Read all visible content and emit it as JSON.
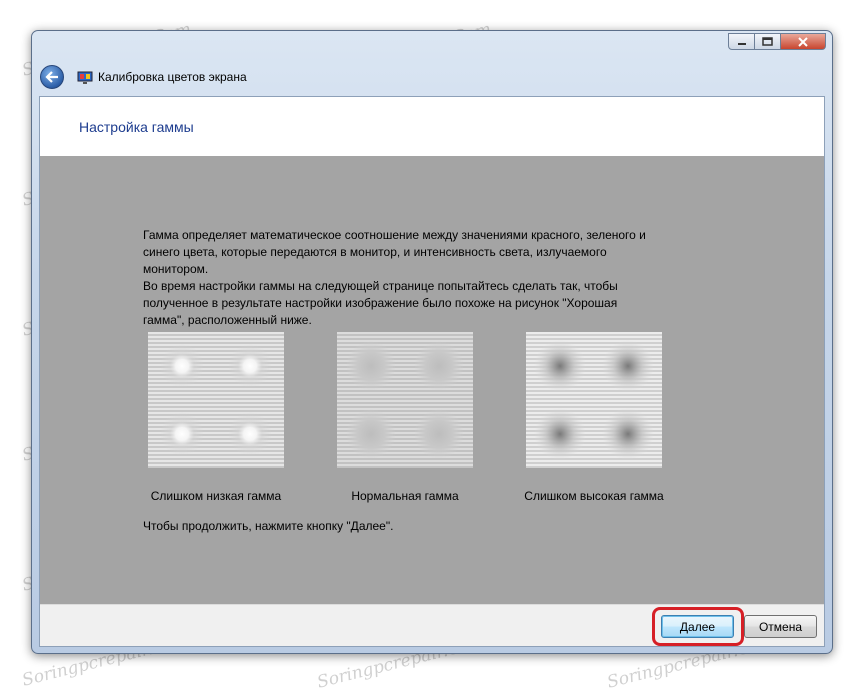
{
  "window": {
    "title": "Калибровка цветов экрана",
    "caption_buttons": [
      "minimize-icon",
      "maximize-icon",
      "close-icon"
    ]
  },
  "page": {
    "heading": "Настройка гаммы",
    "paragraph_lines": [
      "Гамма определяет математическое соотношение между значениями красного, зеленого и",
      "синего цвета, которые передаются в монитор, и интенсивность света, излучаемого",
      "монитором.",
      "Во время настройки гаммы на следующей странице попытайтесь сделать так, чтобы",
      "полученное в результате настройки изображение было похоже на рисунок \"Хорошая",
      "гамма\", расположенный ниже."
    ],
    "samples": [
      {
        "label": "Слишком низкая гамма"
      },
      {
        "label": "Нормальная гамма"
      },
      {
        "label": "Слишком высокая гамма"
      }
    ],
    "continue_text": "Чтобы продолжить, нажмите кнопку \"Далее\"."
  },
  "footer": {
    "next_label": "Далее",
    "cancel_label": "Отмена"
  },
  "watermark": "Sоringpcrepair.Com",
  "colors": {
    "heading": "#1e3d8f",
    "content_background": "#a4a4a4",
    "highlight": "#d61f26"
  }
}
